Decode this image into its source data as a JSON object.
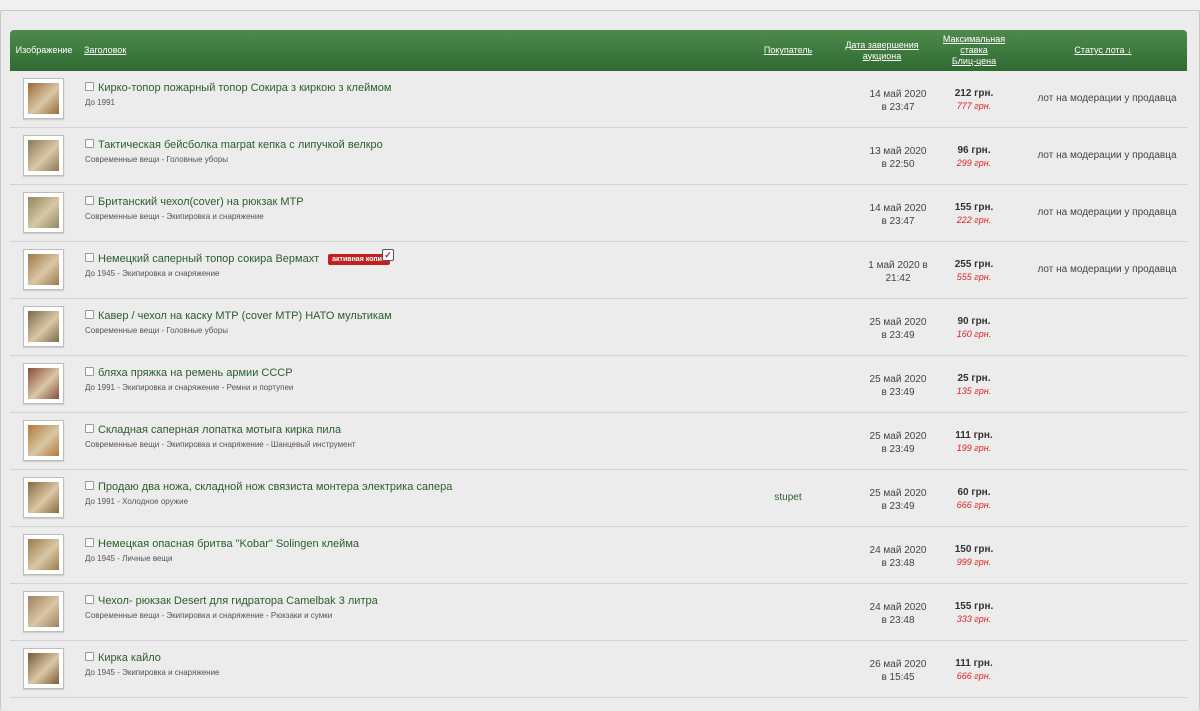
{
  "header": {
    "image": "Изображение",
    "title": "Заголовок",
    "buyer": "Покупатель",
    "date_line1": "Дата завершения",
    "date_line2": "аукциона",
    "bid_line1": "Максимальная",
    "bid_line2": "ставка",
    "bid_line3": "Блиц-цена",
    "status": "Статус лота ↓"
  },
  "badge_label": "активная копия",
  "rows": [
    {
      "title": "Кирко-топор пожарный топор Сокира з киркою з клеймом",
      "category": "До 1991",
      "buyer": "",
      "date": "14 май 2020",
      "time": "в 23:47",
      "price": "212 грн.",
      "blitz": "777 грн.",
      "status": "лот на модерации у продавца",
      "thumb_color": "#9a6a3a"
    },
    {
      "title": "Тактическая бейсболка marpat кепка с липучкой велкро",
      "category": "Современные вещи - Головные уборы",
      "buyer": "",
      "date": "13 май 2020",
      "time": "в 22:50",
      "price": "96 грн.",
      "blitz": "299 грн.",
      "status": "лот на модерации у продавца",
      "thumb_color": "#8a7a5a"
    },
    {
      "title": "Британский чехол(cover) на рюкзак МТР",
      "category": "Современные вещи - Экипировка и снаряжение",
      "buyer": "",
      "date": "14 май 2020",
      "time": "в 23:47",
      "price": "155 грн.",
      "blitz": "222 грн.",
      "status": "лот на модерации у продавца",
      "thumb_color": "#8c8860"
    },
    {
      "title": "Немецкий саперный топор сокира Вермахт",
      "category": "До 1945 - Экипировка и снаряжение",
      "buyer": "",
      "date": "1 май 2020 в",
      "time": "21:42",
      "price": "255 грн.",
      "blitz": "555 грн.",
      "status": "лот на модерации у продавца",
      "thumb_color": "#a07848",
      "badge": true
    },
    {
      "title": "Кавер / чехол на каску МТР (cover MTP) НАТО мультикам",
      "category": "Современные вещи - Головные уборы",
      "buyer": "",
      "date": "25 май 2020",
      "time": "в 23:49",
      "price": "90 грн.",
      "blitz": "160 грн.",
      "status": "",
      "thumb_color": "#7a6a4a"
    },
    {
      "title": "бляха пряжка на ремень армии СССР",
      "category": "До 1991 - Экипировка и снаряжение - Ремни и портупеи",
      "buyer": "",
      "date": "25 май 2020",
      "time": "в 23:49",
      "price": "25 грн.",
      "blitz": "135 грн.",
      "status": "",
      "thumb_color": "#8a4a3a"
    },
    {
      "title": "Складная саперная лопатка мотыга кирка пила",
      "category": "Современные вещи - Экипировка и снаряжение - Шанцевый инструмент",
      "buyer": "",
      "date": "25 май 2020",
      "time": "в 23:49",
      "price": "111 грн.",
      "blitz": "199 грн.",
      "status": "",
      "thumb_color": "#b07a3a"
    },
    {
      "title": "Продаю два ножа, складной нож связиста монтера электрика сапера",
      "category": "До 1991 - Холодное оружие",
      "buyer": "stupet",
      "date": "25 май 2020",
      "time": "в 23:49",
      "price": "60 грн.",
      "blitz": "666 грн.",
      "status": "",
      "thumb_color": "#8a6a40"
    },
    {
      "title": "Немецкая опасная бритва \"Kobar\" Solingen клейма",
      "category": "До 1945 - Личные вещи",
      "buyer": "",
      "date": "24 май 2020",
      "time": "в 23:48",
      "price": "150 грн.",
      "blitz": "999 грн.",
      "status": "",
      "thumb_color": "#9a7a4a"
    },
    {
      "title": "Чехол- рюкзак Desert для гидратора Camelbak 3 литра",
      "category": "Современные вещи - Экипировка и снаряжение - Рюкзаки и сумки",
      "buyer": "",
      "date": "24 май 2020",
      "time": "в 23:48",
      "price": "155 грн.",
      "blitz": "333 грн.",
      "status": "",
      "thumb_color": "#a08060"
    },
    {
      "title": "Кирка кайло",
      "category": "До 1945 - Экипировка и снаряжение",
      "buyer": "",
      "date": "26 май 2020",
      "time": "в 15:45",
      "price": "111 грн.",
      "blitz": "666 грн.",
      "status": "",
      "thumb_color": "#7a5a3a"
    }
  ]
}
